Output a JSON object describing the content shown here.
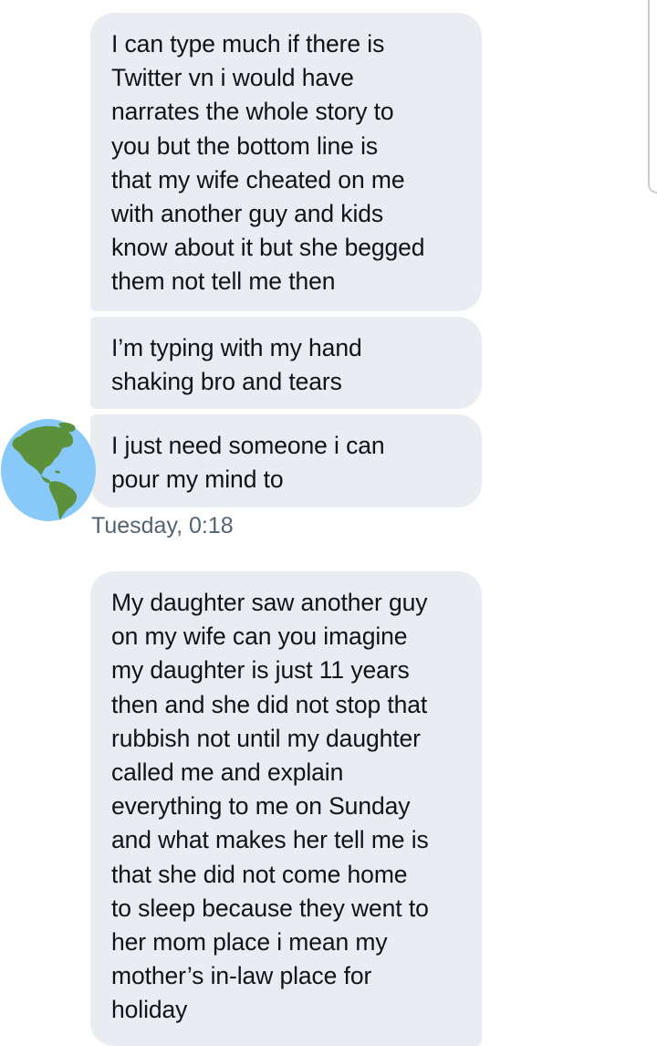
{
  "conversation": {
    "messages": [
      {
        "text": "I can type much if there is\nTwitter vn i would have\nnarrates the whole story to\nyou  but the bottom line is\nthat my wife cheated on me\nwith another guy and kids\nknow about it but she begged\nthem not tell me then"
      },
      {
        "text": "I’m typing with my hand\nshaking bro and tears"
      },
      {
        "text": "I just need someone i can\npour my mind to"
      },
      {
        "text": "My daughter saw another guy\non my wife can you imagine\nmy daughter is just 11 years\nthen and she did not stop that\nrubbish not until my daughter\ncalled me and explain\neverything to me on Sunday\nand what makes her tell me is\nthat she did not come home\nto sleep because they went to\nher mom place i mean my\nmother’s in-law place for\nholiday"
      }
    ],
    "timestamp": "Tuesday, 0:18",
    "avatar_icon": "globe-americas-icon"
  },
  "colors": {
    "bubble_background": "#e9edf2",
    "text": "#0f1419",
    "timestamp": "#536471",
    "globe_ocean": "#88c9f9",
    "globe_land": "#5c913b"
  }
}
